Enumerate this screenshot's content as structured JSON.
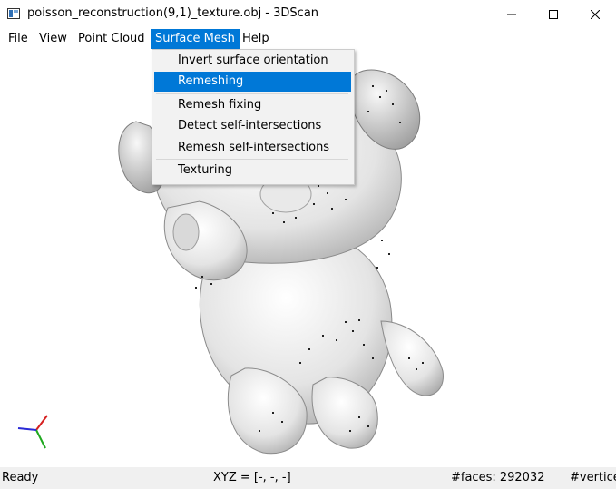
{
  "window": {
    "title": "poisson_reconstruction(9,1)_texture.obj - 3DScan",
    "icon": "app-window-icon",
    "controls": [
      "minimize-icon",
      "maximize-icon",
      "close-icon"
    ]
  },
  "menubar": {
    "items": [
      {
        "label": "File"
      },
      {
        "label": "View"
      },
      {
        "label": "Point Cloud"
      },
      {
        "label": "Surface Mesh",
        "active": true
      },
      {
        "label": "Help"
      }
    ]
  },
  "dropdown": {
    "items": [
      {
        "label": "Invert surface orientation"
      },
      {
        "label": "Remeshing",
        "highlighted": true
      },
      {
        "label": "Remesh fixing"
      },
      {
        "label": "Detect self-intersections"
      },
      {
        "label": "Remesh self-intersections"
      },
      {
        "label": "Texturing"
      }
    ]
  },
  "viewport": {
    "model": "textured-mesh-dog",
    "axes_icon": "xyz-axes-icon",
    "colors": {
      "axis_x": "#d62020",
      "axis_y": "#1fa81f",
      "axis_z": "#2a2ad6"
    }
  },
  "statusbar": {
    "state": "Ready",
    "xyz": "XYZ = [-, -, -]",
    "faces": "#faces: 292032",
    "vertices": "#vertice"
  },
  "colors": {
    "accent": "#0078d7",
    "menu_bg": "#f2f2f2",
    "status_bg": "#f0f0f0"
  }
}
